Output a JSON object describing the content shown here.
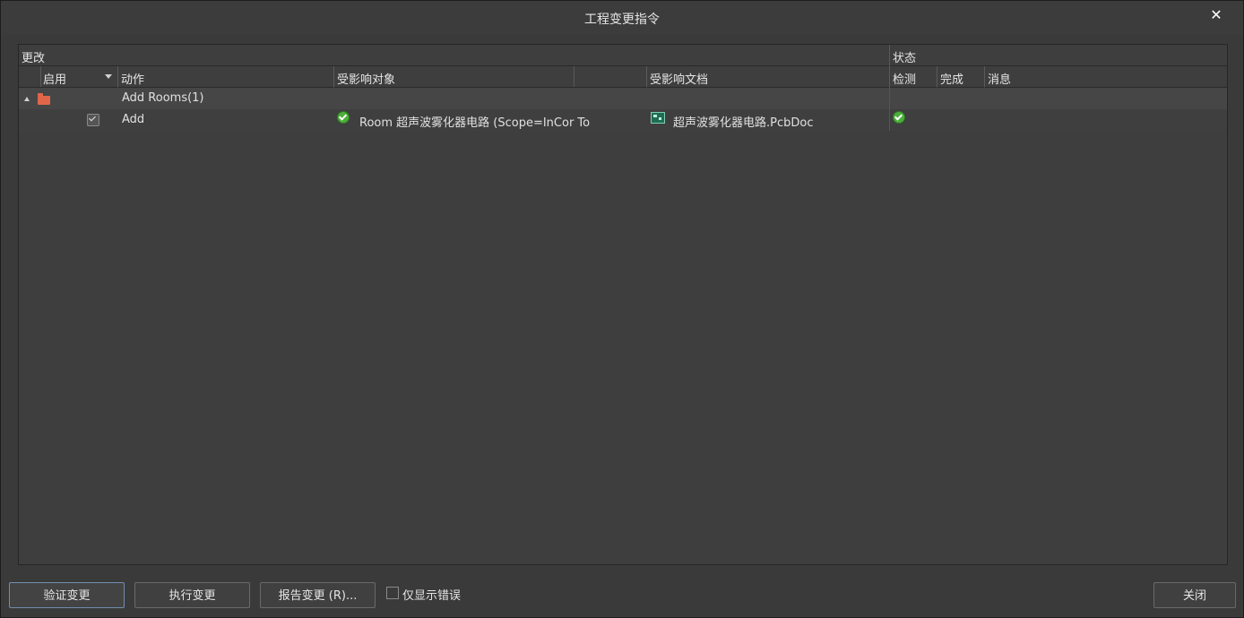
{
  "window": {
    "title": "工程变更指令",
    "close_label": "✕"
  },
  "table": {
    "group_headers": {
      "changes": "更改",
      "status": "状态"
    },
    "columns": {
      "enable": "启用",
      "action": "动作",
      "affected_object": "受影响对象",
      "affected_document": "受影响文档",
      "check": "检测",
      "done": "完成",
      "message": "消息"
    },
    "rows": [
      {
        "type": "group",
        "expanded": true,
        "icon": "folder-icon",
        "action": "Add Rooms(1)"
      },
      {
        "type": "item",
        "enabled": true,
        "action": "Add",
        "object_icon": "check-icon",
        "affected_object": "Room 超声波雾化器电路 (Scope=InCor To",
        "document_icon": "pcb-document-icon",
        "affected_document": "超声波雾化器电路.PcbDoc",
        "check_status": "check-icon"
      }
    ]
  },
  "footer": {
    "validate_label": "验证变更",
    "execute_label": "执行变更",
    "report_label": "报告变更 (R)...",
    "only_errors_label": "仅显示错误",
    "only_errors_checked": false,
    "close_label": "关闭"
  },
  "colors": {
    "success": "#4caf3a",
    "folder": "#e0664a",
    "accent_border": "#6f8fb0"
  }
}
